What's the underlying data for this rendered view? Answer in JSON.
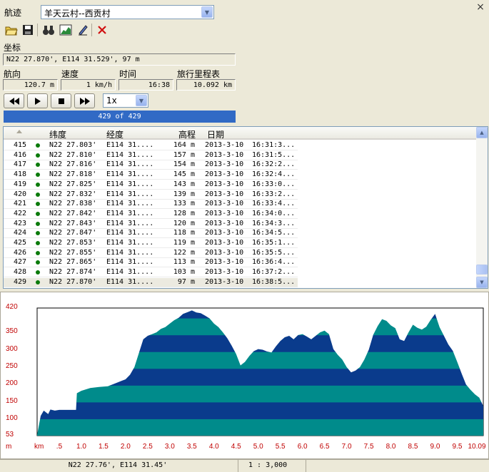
{
  "track": {
    "label": "航迹",
    "selected": "羊天云村--西贡村"
  },
  "window": {
    "close": "×"
  },
  "toolbar": {
    "icons": [
      "open-folder-icon",
      "save-icon",
      "binoculars-icon",
      "chart-icon",
      "pen-icon",
      "delete-icon"
    ]
  },
  "coord": {
    "label": "坐标",
    "value": "N22 27.870', E114 31.529', 97 m"
  },
  "stats": {
    "heading_label": "航向",
    "heading": "120.7 m",
    "speed_label": "速度",
    "speed": "1 km/h",
    "time_label": "时间",
    "time": "16:38",
    "odometer_label": "旅行里程表",
    "odometer": "10.092 km"
  },
  "playback": {
    "speed": "1x",
    "progress": "429 of 429",
    "progress_fraction": 1.0
  },
  "table": {
    "columns": [
      "",
      "纬度",
      "经度",
      "高程",
      "日期"
    ],
    "rows": [
      [
        "415",
        "N22 27.803'",
        "E114 31....",
        "164 m",
        "2013-3-10",
        "16:31:3..."
      ],
      [
        "416",
        "N22 27.810'",
        "E114 31....",
        "157 m",
        "2013-3-10",
        "16:31:5..."
      ],
      [
        "417",
        "N22 27.816'",
        "E114 31....",
        "154 m",
        "2013-3-10",
        "16:32:2..."
      ],
      [
        "418",
        "N22 27.818'",
        "E114 31....",
        "145 m",
        "2013-3-10",
        "16:32:4..."
      ],
      [
        "419",
        "N22 27.825'",
        "E114 31....",
        "143 m",
        "2013-3-10",
        "16:33:0..."
      ],
      [
        "420",
        "N22 27.832'",
        "E114 31....",
        "139 m",
        "2013-3-10",
        "16:33:2..."
      ],
      [
        "421",
        "N22 27.838'",
        "E114 31....",
        "133 m",
        "2013-3-10",
        "16:33:4..."
      ],
      [
        "422",
        "N22 27.842'",
        "E114 31....",
        "128 m",
        "2013-3-10",
        "16:34:0..."
      ],
      [
        "423",
        "N22 27.843'",
        "E114 31....",
        "120 m",
        "2013-3-10",
        "16:34:3..."
      ],
      [
        "424",
        "N22 27.847'",
        "E114 31....",
        "118 m",
        "2013-3-10",
        "16:34:5..."
      ],
      [
        "425",
        "N22 27.853'",
        "E114 31....",
        "119 m",
        "2013-3-10",
        "16:35:1..."
      ],
      [
        "426",
        "N22 27.855'",
        "E114 31....",
        "122 m",
        "2013-3-10",
        "16:35:5..."
      ],
      [
        "427",
        "N22 27.865'",
        "E114 31....",
        "113 m",
        "2013-3-10",
        "16:36:4..."
      ],
      [
        "428",
        "N22 27.874'",
        "E114 31....",
        "103 m",
        "2013-3-10",
        "16:37:2..."
      ],
      [
        "429",
        "N22 27.870'",
        "E114 31....",
        "97 m",
        "2013-3-10",
        "16:38:5..."
      ]
    ],
    "selected_index": 14
  },
  "chart_data": {
    "type": "area",
    "ylabel": "m",
    "xlabel": "km",
    "yticks": [
      "420",
      "350",
      "300",
      "250",
      "200",
      "150",
      "100",
      "53"
    ],
    "xticks": [
      ".5",
      "1.0",
      "1.5",
      "2.0",
      "2.5",
      "3.0",
      "3.5",
      "4.0",
      "4.5",
      "5.0",
      "5.5",
      "6.0",
      "6.5",
      "7.0",
      "7.5",
      "8.0",
      "8.5",
      "9.0",
      "9.5",
      "10.09"
    ],
    "ylim": [
      53,
      420
    ],
    "xlim": [
      0,
      10.09
    ],
    "band_colors": [
      "#008b8b",
      "#0a3b8c"
    ],
    "x": [
      0,
      0.08,
      0.15,
      0.25,
      0.3,
      0.4,
      0.5,
      0.6,
      0.75,
      0.88,
      0.9,
      1.0,
      1.2,
      1.4,
      1.6,
      1.8,
      1.9,
      2.0,
      2.1,
      2.2,
      2.3,
      2.4,
      2.5,
      2.6,
      2.7,
      2.8,
      2.9,
      3.0,
      3.1,
      3.2,
      3.3,
      3.4,
      3.5,
      3.6,
      3.7,
      3.8,
      3.9,
      4.0,
      4.1,
      4.2,
      4.3,
      4.4,
      4.5,
      4.6,
      4.7,
      4.8,
      4.9,
      5.0,
      5.1,
      5.2,
      5.3,
      5.4,
      5.5,
      5.6,
      5.7,
      5.8,
      5.9,
      6.0,
      6.1,
      6.2,
      6.3,
      6.4,
      6.5,
      6.6,
      6.7,
      6.8,
      6.9,
      7.0,
      7.1,
      7.2,
      7.3,
      7.4,
      7.5,
      7.6,
      7.7,
      7.8,
      7.9,
      8.0,
      8.1,
      8.2,
      8.3,
      8.4,
      8.5,
      8.6,
      8.7,
      8.8,
      8.9,
      9.0,
      9.1,
      9.2,
      9.3,
      9.4,
      9.5,
      9.6,
      9.7,
      9.8,
      9.9,
      10.0,
      10.09
    ],
    "y": [
      55,
      110,
      125,
      115,
      128,
      125,
      127,
      127,
      127,
      127,
      175,
      182,
      190,
      193,
      195,
      205,
      210,
      215,
      228,
      250,
      290,
      330,
      340,
      345,
      350,
      360,
      365,
      375,
      385,
      392,
      403,
      408,
      413,
      407,
      405,
      398,
      390,
      375,
      365,
      350,
      333,
      312,
      288,
      255,
      265,
      282,
      296,
      302,
      300,
      295,
      292,
      310,
      325,
      336,
      340,
      330,
      342,
      345,
      338,
      330,
      340,
      350,
      355,
      345,
      302,
      285,
      272,
      250,
      235,
      240,
      250,
      272,
      300,
      343,
      368,
      388,
      383,
      370,
      362,
      330,
      325,
      350,
      372,
      363,
      358,
      366,
      386,
      403,
      365,
      340,
      315,
      297,
      265,
      232,
      200,
      185,
      172,
      162,
      138,
      112,
      100
    ]
  },
  "statusbar": {
    "coord": "N22 27.76', E114 31.45'",
    "scale": "1 : 3,000"
  }
}
